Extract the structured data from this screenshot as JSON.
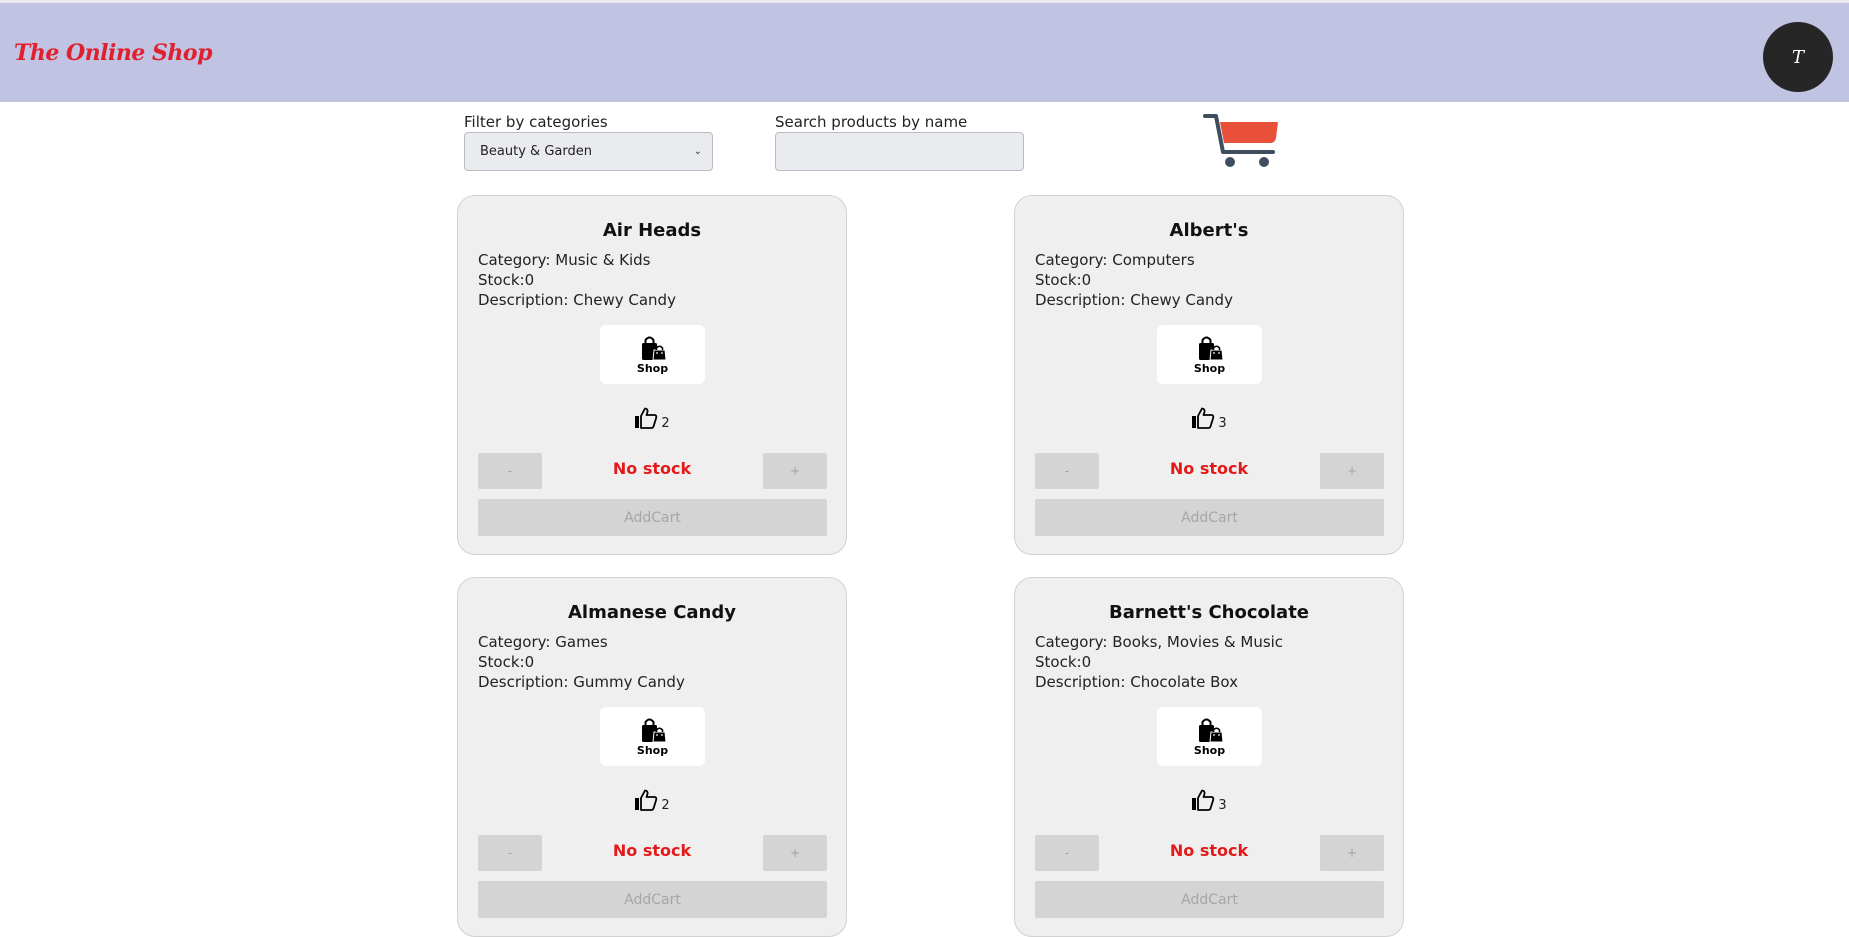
{
  "header": {
    "brand": "The Online Shop",
    "avatar_initial": "T"
  },
  "filters": {
    "category_label": "Filter by categories",
    "category_selected": "Beauty & Garden",
    "search_label": "Search products by name",
    "search_value": "",
    "search_placeholder": ""
  },
  "icons": {
    "cart": "cart-icon",
    "shop": "shopping-bags-icon",
    "like": "thumbs-up-icon"
  },
  "colors": {
    "header_bg": "#c0c3e1",
    "brand": "#e0202f",
    "no_stock": "#e41a1a",
    "cart_basket": "#e8503a",
    "cart_frame": "#3e4e5e"
  },
  "products": [
    {
      "name": "Air Heads",
      "category": "Category: Music & Kids",
      "stock": "Stock:0",
      "description": "Description: Chewy Candy",
      "shop_label": "Shop",
      "likes": "2",
      "minus": "-",
      "plus": "+",
      "status": "No stock",
      "add_label": "AddCart"
    },
    {
      "name": "Albert's",
      "category": "Category: Computers",
      "stock": "Stock:0",
      "description": "Description: Chewy Candy",
      "shop_label": "Shop",
      "likes": "3",
      "minus": "-",
      "plus": "+",
      "status": "No stock",
      "add_label": "AddCart"
    },
    {
      "name": "Almanese Candy",
      "category": "Category: Games",
      "stock": "Stock:0",
      "description": "Description: Gummy Candy",
      "shop_label": "Shop",
      "likes": "2",
      "minus": "-",
      "plus": "+",
      "status": "No stock",
      "add_label": "AddCart"
    },
    {
      "name": "Barnett's Chocolate",
      "category": "Category: Books, Movies & Music",
      "stock": "Stock:0",
      "description": "Description: Chocolate Box",
      "shop_label": "Shop",
      "likes": "3",
      "minus": "-",
      "plus": "+",
      "status": "No stock",
      "add_label": "AddCart"
    }
  ]
}
